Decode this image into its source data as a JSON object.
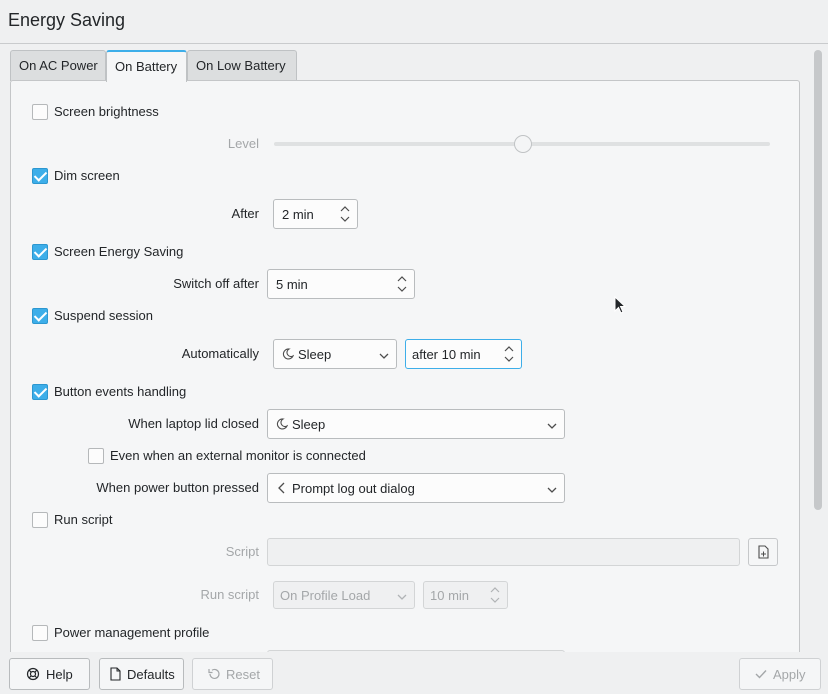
{
  "window": {
    "title": "Energy Saving"
  },
  "tabs": [
    {
      "label": "On AC Power",
      "active": false
    },
    {
      "label": "On Battery",
      "active": true
    },
    {
      "label": "On Low Battery",
      "active": false
    }
  ],
  "screen_brightness": {
    "label": "Screen brightness",
    "checked": false,
    "level_label": "Level",
    "level_fraction": 0.5
  },
  "dim_screen": {
    "label": "Dim screen",
    "checked": true,
    "after_label": "After",
    "after_value": "2 min"
  },
  "screen_energy_saving": {
    "label": "Screen Energy Saving",
    "checked": true,
    "switch_off_label": "Switch off after",
    "switch_off_value": "5 min"
  },
  "suspend_session": {
    "label": "Suspend session",
    "checked": true,
    "auto_label": "Automatically",
    "auto_action": "Sleep",
    "auto_after": "after 10 min"
  },
  "button_events": {
    "label": "Button events handling",
    "checked": true,
    "lid_label": "When laptop lid closed",
    "lid_value": "Sleep",
    "external_monitor_label": "Even when an external monitor is connected",
    "external_monitor_checked": false,
    "power_button_label": "When power button pressed",
    "power_button_value": "Prompt log out dialog"
  },
  "run_script": {
    "label": "Run script",
    "checked": false,
    "script_label": "Script",
    "script_value": "",
    "run_label": "Run script",
    "run_value": "On Profile Load",
    "run_after": "10 min"
  },
  "power_profile": {
    "label": "Power management profile",
    "checked": false
  },
  "footer": {
    "help": "Help",
    "defaults": "Defaults",
    "reset": "Reset",
    "apply": "Apply"
  },
  "colors": {
    "accent": "#3daee9",
    "window_bg": "#eff0f1"
  }
}
